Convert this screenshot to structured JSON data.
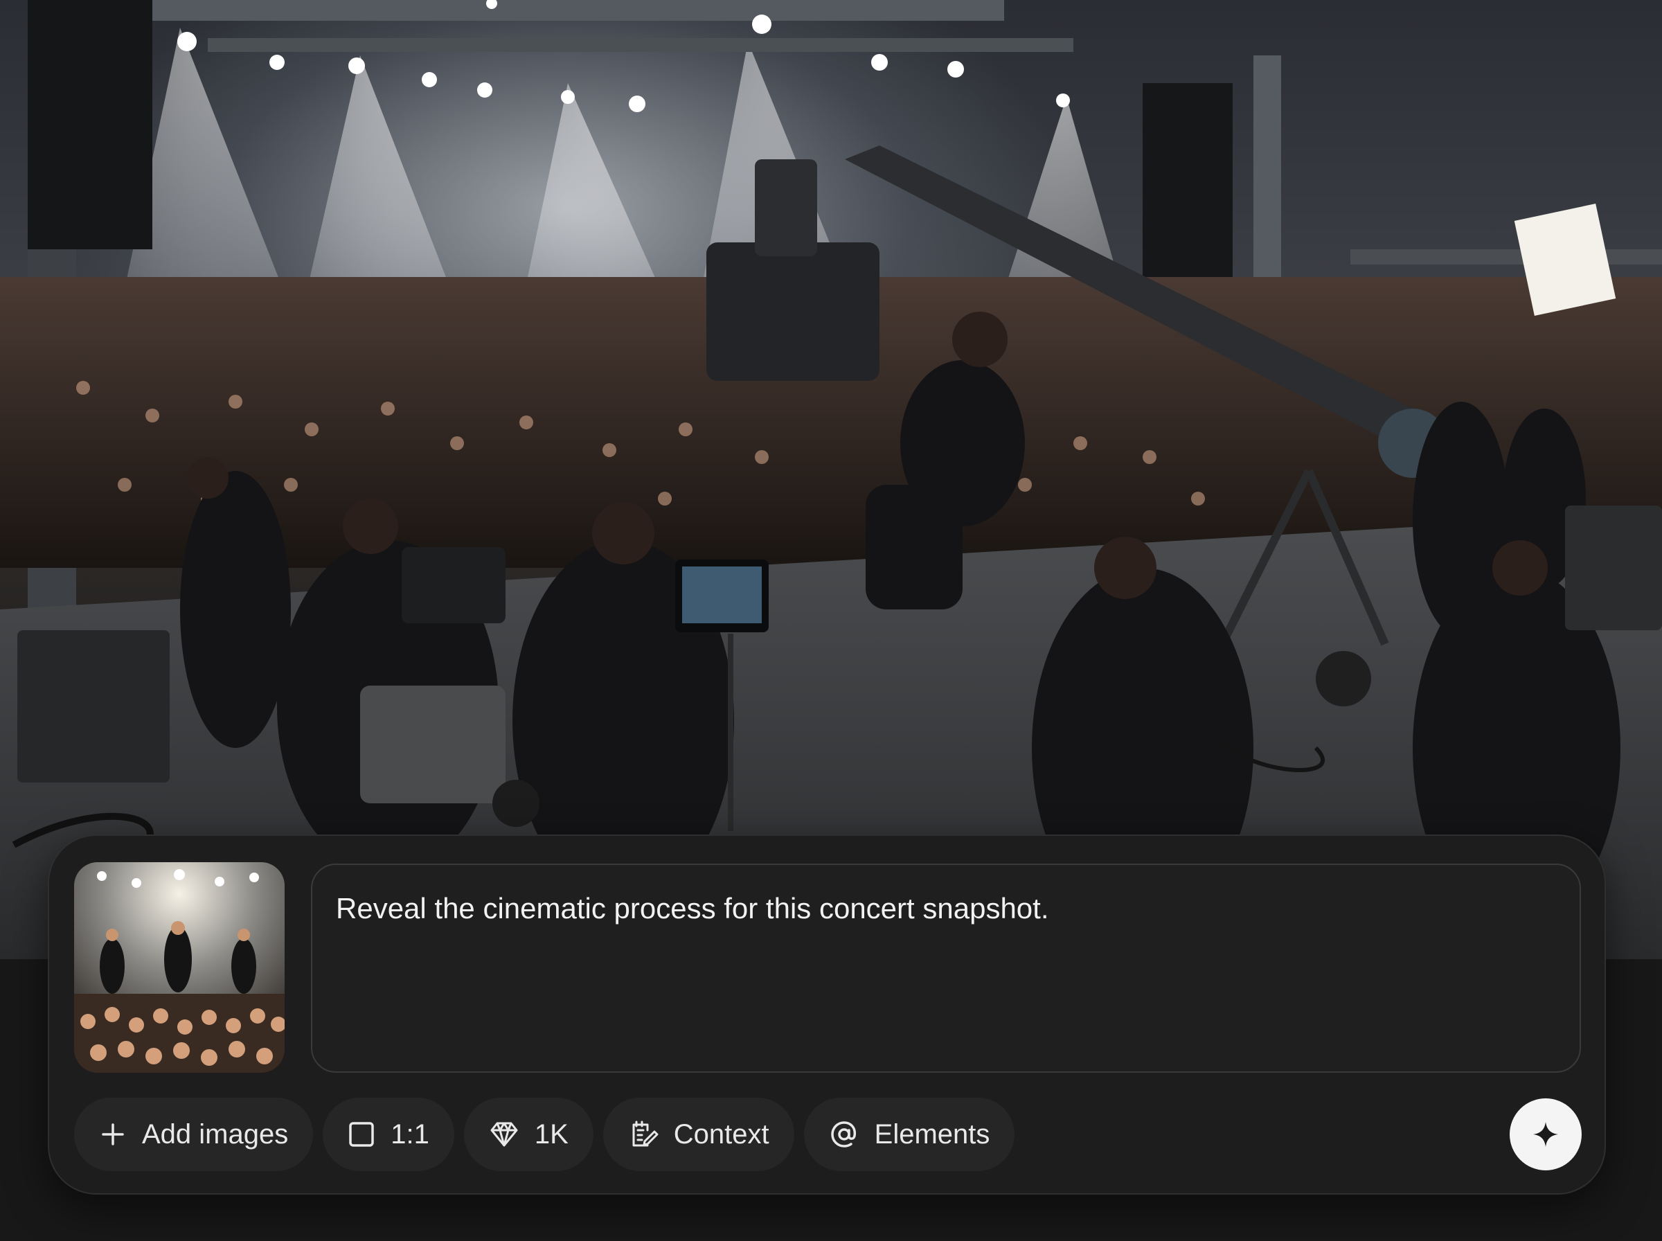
{
  "composer": {
    "prompt_text": "Reveal the cinematic process for this concert snapshot.",
    "toolbar": {
      "add_images_label": "Add images",
      "aspect_ratio_label": "1:1",
      "resolution_label": "1K",
      "context_label": "Context",
      "elements_label": "Elements"
    }
  },
  "icons": {
    "add_images": "plus-icon",
    "aspect_ratio": "square-icon",
    "resolution": "diamond-icon",
    "context": "edit-note-icon",
    "elements": "at-sign-icon",
    "send": "sparkle-icon"
  },
  "colors": {
    "composer_background": "#1d1d1d",
    "chip_background": "#262626",
    "send_button": "#f4f4f4",
    "text": "#f2f2f2"
  }
}
